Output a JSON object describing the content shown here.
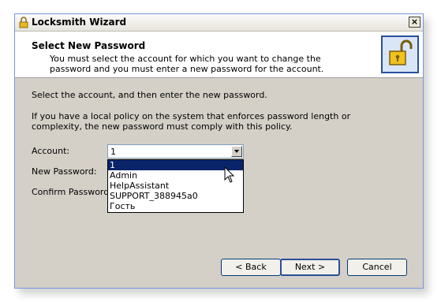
{
  "window": {
    "title": "Locksmith Wizard",
    "close_label": "×"
  },
  "header": {
    "title": "Select New Password",
    "subtitle": "You must select the account for which you want to change the password and you must enter a new password for the account."
  },
  "body": {
    "instruction": "Select the account, and then enter the new password.",
    "policy": "If you have a local policy on the system that enforces password length or complexity, the new password must comply with this policy."
  },
  "form": {
    "account_label": "Account:",
    "new_password_label": "New Password:",
    "confirm_password_label": "Confirm Password:",
    "account_value": "1",
    "account_options": [
      "1",
      "Admin",
      "HelpAssistant",
      "SUPPORT_388945a0",
      "Гость"
    ],
    "selected_index": 0
  },
  "buttons": {
    "back": "< Back",
    "next": "Next >",
    "cancel": "Cancel"
  },
  "icons": {
    "title": "padlock-icon",
    "header": "open-padlock-icon",
    "pointer": "mouse-cursor-icon"
  },
  "colors": {
    "selection": "#0a246a",
    "dialog_bg": "#d4d0c8",
    "header_icon_border": "#2a4f9c"
  }
}
